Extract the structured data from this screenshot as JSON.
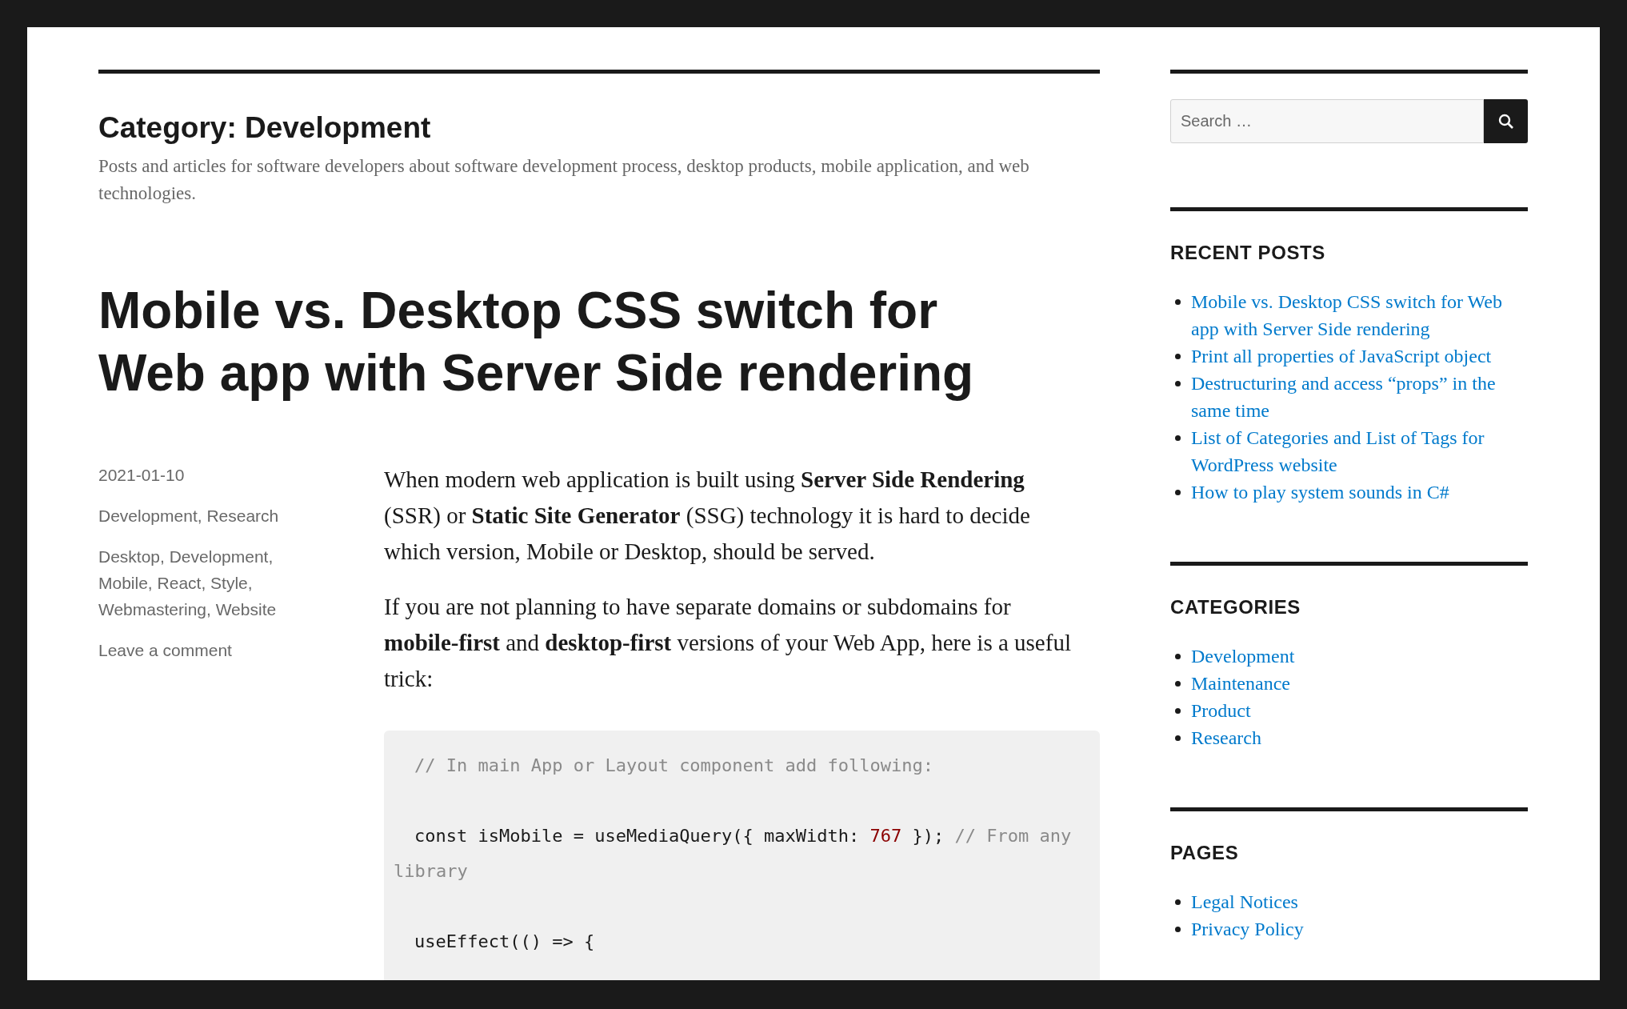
{
  "archive": {
    "title": "Category: Development",
    "description": "Posts and articles for software developers about software development process, desktop products, mobile application, and web technologies."
  },
  "post": {
    "title": "Mobile vs. Desktop CSS switch for Web app with Server Side rendering",
    "meta": {
      "date": "2021-01-10",
      "categories": "Development, Research",
      "tags": "Desktop, Development, Mobile, React, Style, Webmastering, Website",
      "comment_link": "Leave a comment"
    },
    "paragraphs": [
      "When modern web application is built using **Server Side Rendering** (SSR) or **Static Site Generator** (SSG) technology it is hard to decide which version, Mobile or Desktop, should be served.",
      "If you are not planning to have separate domains or subdomains for **mobile-first** and **desktop-first** versions of your Web App, here is a useful trick:"
    ],
    "code_lines": [
      [
        {
          "kind": "comment",
          "text": "// In main App or Layout component add following:"
        }
      ],
      [
        {
          "kind": "code",
          "text": "const isMobile = useMediaQuery({ maxWidth: "
        },
        {
          "kind": "number",
          "text": "767"
        },
        {
          "kind": "code",
          "text": " }); "
        },
        {
          "kind": "comment",
          "text": "// From any library"
        }
      ],
      [
        {
          "kind": "code",
          "text": "useEffect(() => {"
        }
      ]
    ]
  },
  "sidebar": {
    "search": {
      "placeholder": "Search …"
    },
    "widgets": [
      {
        "title": "RECENT POSTS",
        "links": [
          "Mobile vs. Desktop CSS switch for Web app with Server Side rendering",
          "Print all properties of JavaScript object",
          "Destructuring and access “props” in the same time",
          "List of Categories and List of Tags for WordPress website",
          "How to play system sounds in C#"
        ]
      },
      {
        "title": "CATEGORIES",
        "links": [
          "Development",
          "Maintenance",
          "Product",
          "Research"
        ]
      },
      {
        "title": "PAGES",
        "links": [
          "Legal Notices",
          "Privacy Policy"
        ]
      }
    ]
  }
}
